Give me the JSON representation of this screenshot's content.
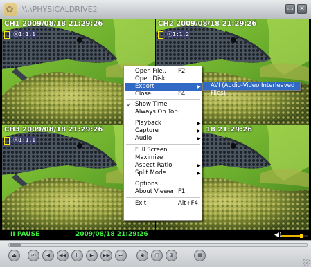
{
  "window": {
    "title": "\\\\.\\PHYSICALDRIVE2",
    "minimize_glyph": "▭",
    "close_glyph": "✕"
  },
  "channels": [
    {
      "label": "CH1 2009/08/18 21:29:26",
      "sub": "ⓧ1:1.1"
    },
    {
      "label": "CH2 2009/08/18 21:29:26",
      "sub": "ⓧ1:1.2"
    },
    {
      "label": "CH3 2009/08/18 21:29:26",
      "sub": "ⓧ1:1.1"
    },
    {
      "label": "18 21:29:26",
      "sub": ""
    }
  ],
  "menu": {
    "items": [
      {
        "label": "Open File..",
        "key": "F2"
      },
      {
        "label": "Open Disk..",
        "key": ""
      },
      {
        "label": "Export",
        "key": "",
        "submenu": true,
        "highlighted": true
      },
      {
        "label": "Close",
        "key": "F4"
      },
      {
        "label": "Show Time",
        "key": "",
        "checked": true
      },
      {
        "label": "Always On Top",
        "key": ""
      },
      {
        "label": "Playback",
        "key": "",
        "submenu": true
      },
      {
        "label": "Capture",
        "key": "",
        "submenu": true
      },
      {
        "label": "Audio",
        "key": "",
        "submenu": true
      },
      {
        "label": "Full Screen",
        "key": ""
      },
      {
        "label": "Maximize",
        "key": ""
      },
      {
        "label": "Aspect Ratio",
        "key": "",
        "submenu": true
      },
      {
        "label": "Split Mode",
        "key": "",
        "submenu": true
      },
      {
        "label": "Options..",
        "key": ""
      },
      {
        "label": "About Viewer",
        "key": "F1"
      },
      {
        "label": "Exit",
        "key": "Alt+F4"
      }
    ],
    "check_glyph": "✓",
    "arrow_glyph": "▶"
  },
  "submenu": {
    "export_option": "AVI (Audio-Video Interleaved Files)"
  },
  "status": {
    "state": "II   PAUSE",
    "datetime": "2009/08/18 21:29:26",
    "volume_icon": "◀)",
    "volume_level": 0.8
  },
  "controls": {
    "icons": [
      "eject-icon",
      "skip-back-icon",
      "step-back-icon",
      "rewind-icon",
      "pause-icon",
      "play-icon",
      "fast-forward-icon",
      "skip-forward-icon",
      "camera-icon",
      "single-view-icon",
      "quad-view-icon",
      "grid-view-icon"
    ],
    "glyphs": [
      "⏏",
      "⏮",
      "◀",
      "◀◀",
      "II",
      "▶",
      "▶▶",
      "⏭",
      "◉",
      "▢",
      "⊞",
      "▦"
    ]
  },
  "colors": {
    "status_green": "#3cf040",
    "menu_highlight": "#316ac5",
    "rec_box": "#ffe800"
  }
}
